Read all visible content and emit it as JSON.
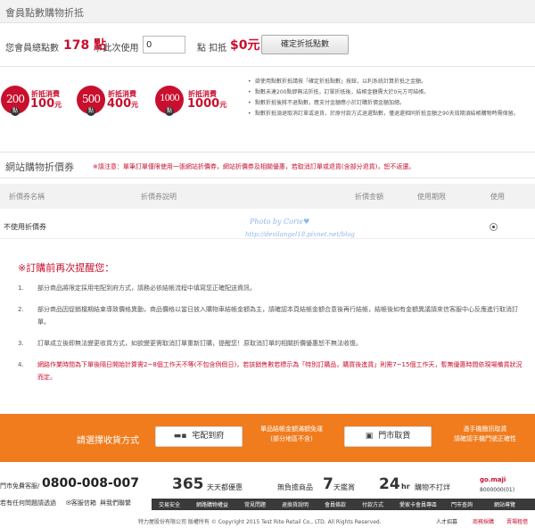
{
  "header": {
    "title": "會員點數購物折抵"
  },
  "points": {
    "label_total": "您會員總點數",
    "total": "178 點",
    "label_use": "/ 此次使用",
    "input_value": "0",
    "label_discount": "點 扣抵",
    "discount_amount": "$0元",
    "confirm_button": "確定折抵點數"
  },
  "tiers": [
    {
      "points": "200",
      "tag": "折抵消費",
      "value": "100",
      "unit": "元",
      "badge_suffix": "點"
    },
    {
      "points": "500",
      "tag": "折抵消費",
      "value": "400",
      "unit": "元",
      "badge_suffix": "點"
    },
    {
      "points": "1000",
      "tag": "折抵消費",
      "value": "1000",
      "unit": "元",
      "badge_suffix": "點"
    }
  ],
  "rules": [
    "欲使用點數折抵請按「確定折抵點數」按鈕，以利系統計算折抵之金額。",
    "點數未達200點即無法折抵，訂單折抵後，結帳金額需大於0元方可結帳。",
    "點數折抵後將不退點數，應支付金額應小於訂購折價金額加總。",
    "點數折抵須退取消訂單或退貨，於原付款方式退還點數，僅退還相同折抵金額之90天效期須結帳購物時需保留。"
  ],
  "coupon": {
    "title": "網站購物折價券",
    "note": "※請注意：單筆訂單僅限使用一張網站折價券，網站折價券及相關優惠，若取消訂單或退貨(含部分退貨)，恕不返還。",
    "columns": [
      "折價券名稱",
      "折價券說明",
      "折價金額",
      "使用期限",
      "使用"
    ],
    "row_label": "不使用折價券"
  },
  "watermark": {
    "line1": "Photo by Corie♥",
    "line2": "http://devilangel18.pixnet.net/blog"
  },
  "reminder": {
    "title": "※訂購前再次提醒您：",
    "items": [
      {
        "num": "1.",
        "text": "部分商品將限定採用宅配到府方式，請務必依結帳流程中填寫您正確配送資訊。"
      },
      {
        "num": "2.",
        "text": "部分商品因促銷檔期結束導致價格異動，商品價格以當日放入購物車結帳金額為主，請確認本頁結帳金額合意後再行結帳，結帳後如有金額異議請來信客服中心反應進行取消訂單。"
      },
      {
        "num": "3.",
        "text": "訂單成立後即無法變更收貨方式，如欲變更需取消訂單重新訂購，提醒您！原取消訂單的相關折價優惠恕不無法收復。"
      },
      {
        "num": "4.",
        "text_a": "網路作業時間為下單後隔日開始計算需2~8個工作天不等(不包含例假日)，若該銷售數若標示為「特別訂購品，購買後進貨」則需7~15個工作天，",
        "text_b": "暫無優惠時間依現場備貨狀況而定。"
      }
    ]
  },
  "shipping": {
    "label": "請選擇收貨方式",
    "home": "宅配到府",
    "home_note_1": "單品結帳金額滿額免運",
    "home_note_2": "(部分地區不含)",
    "store": "門市取貨",
    "store_note_1": "憑手機簡訊取貨",
    "store_note_2": "請確認手機門號正確性"
  },
  "footer": {
    "service_label": "門市免費客服/",
    "phone": "0800-008-007",
    "days_num": "365",
    "days_text": "天天都優惠",
    "worry_text": "無負擔商品",
    "worry_num": "7",
    "worry_unit": "天鑑賞",
    "hours_num": "24",
    "hours_unit": "hr",
    "hours_text": "購物不打烊",
    "question": "若有任何問題請透過",
    "link_service": "客服信箱",
    "link_contact": "與我們聯繫",
    "nav": [
      "交易安全",
      "網路購物權益",
      "常見問題",
      "退換貨說明",
      "會員條款",
      "付款方式",
      "愛家卡會員專區",
      "門市查詢",
      "網站導覽"
    ],
    "gomaji_logo": "go.maji",
    "gomaji_num": "8000000(01)",
    "copyright": "特力屋股份有限公司 版權所有 © Copyright 2015 Test Rite Retail Co., LTD. All Rights Reserved.",
    "link_jobs": "人才招募",
    "link_biz": "商務採購",
    "link_mall": "賣場租借"
  }
}
